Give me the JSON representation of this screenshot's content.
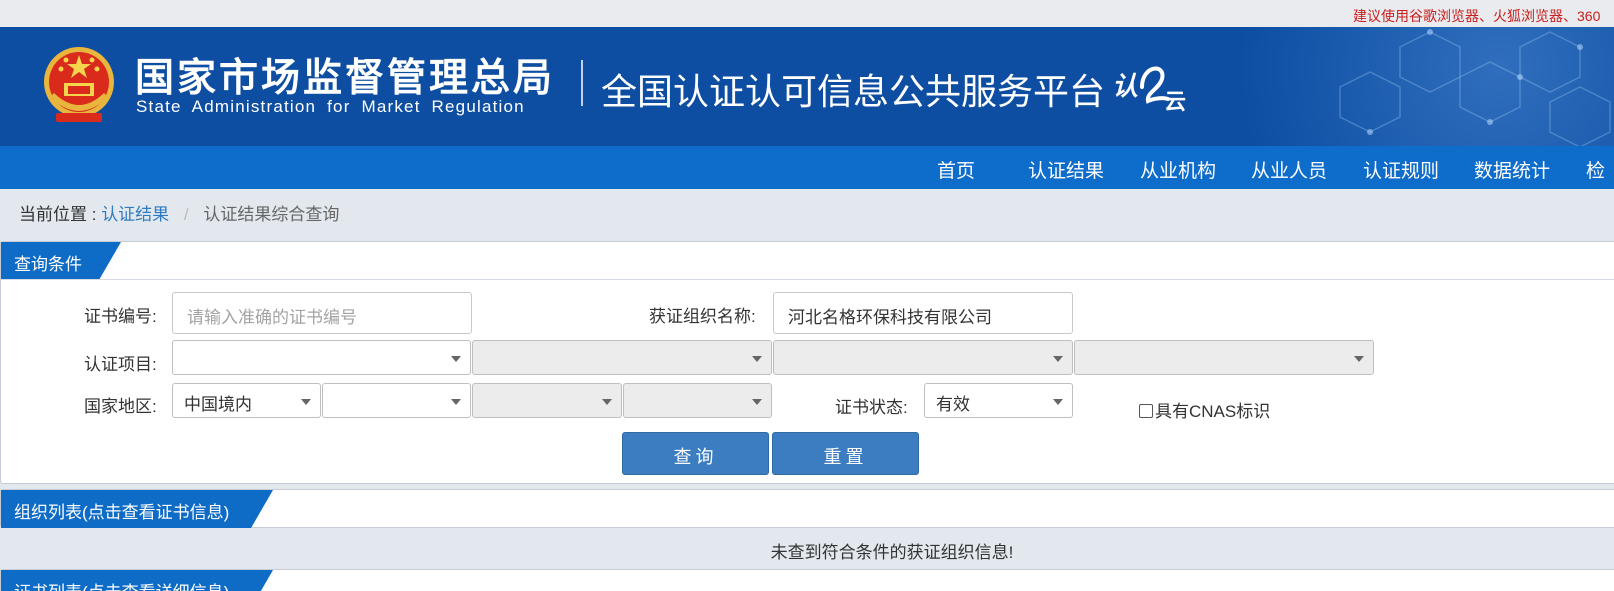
{
  "topbar": {
    "notice": "建议使用谷歌浏览器、火狐浏览器、360"
  },
  "header": {
    "agency_cn": "国家市场监督管理总局",
    "agency_en": "State Administration for Market Regulation",
    "platform_title": "全国认证认可信息公共服务平台",
    "cloud_logo_text": "认云"
  },
  "nav": {
    "items": [
      "首页",
      "认证结果",
      "从业机构",
      "从业人员",
      "认证规则",
      "数据统计",
      "检"
    ]
  },
  "breadcrumb": {
    "label": "当前位置 :",
    "link": "认证结果",
    "separator": "/",
    "current": "认证结果综合查询"
  },
  "query": {
    "title": "查询条件",
    "cert_no_label": "证书编号:",
    "cert_no_placeholder": "请输入准确的证书编号",
    "org_name_label": "获证组织名称:",
    "org_name_value": "河北名格环保科技有限公司",
    "project_label": "认证项目:",
    "project_selects": [
      "",
      "",
      "",
      ""
    ],
    "region_label": "国家地区:",
    "region_selects": [
      "中国境内",
      "",
      "",
      ""
    ],
    "status_label": "证书状态:",
    "status_value": "有效",
    "cnas_label": "具有CNAS标识",
    "cnas_checked": false,
    "search_button": "查询",
    "reset_button": "重置"
  },
  "org_list": {
    "title": "组织列表(点击查看证书信息)",
    "empty_message": "未查到符合条件的获证组织信息!"
  },
  "cert_list": {
    "title": "证书列表(点击查看详细信息)"
  },
  "colors": {
    "banner": "#0d4ea3",
    "nav": "#0e6ccb",
    "accent": "#0f6cc6",
    "button": "#3b7dc0",
    "notice": "#c9201f",
    "link": "#2f7bc2"
  }
}
